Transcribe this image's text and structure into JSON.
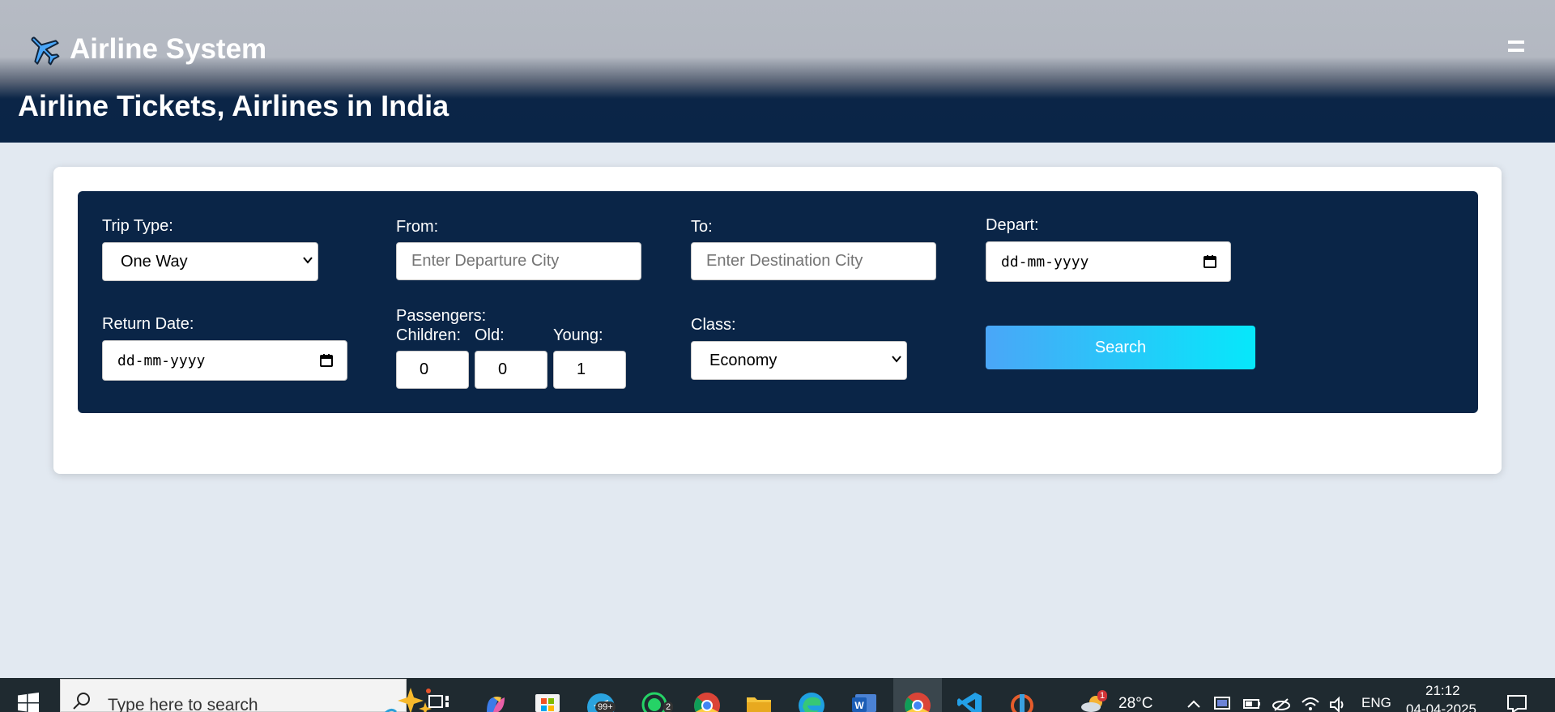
{
  "header": {
    "brand_icon": "airplane-icon",
    "brand_name": "Airline System",
    "menu_icon": "hamburger-menu-icon",
    "page_title": "Airline Tickets, Airlines in India"
  },
  "form": {
    "trip_type": {
      "label": "Trip Type:",
      "value": "One Way"
    },
    "from": {
      "label": "From:",
      "placeholder": "Enter Departure City"
    },
    "to": {
      "label": "To:",
      "placeholder": "Enter Destination City"
    },
    "depart": {
      "label": "Depart:",
      "value": "dd-mm-yyyy"
    },
    "return_date": {
      "label": "Return Date:",
      "value": "dd-mm-yyyy"
    },
    "passengers": {
      "label": "Passengers:",
      "children": {
        "label": "Children:",
        "value": "0"
      },
      "old": {
        "label": "Old:",
        "value": "0"
      },
      "young": {
        "label": "Young:",
        "value": "1"
      }
    },
    "class": {
      "label": "Class:",
      "value": "Economy"
    },
    "search_button": "Search"
  },
  "taskbar": {
    "search_placeholder": "Type here to search",
    "apps": [
      "task-view",
      "copilot",
      "microsoft-store",
      "telegram",
      "whatsapp",
      "chrome",
      "file-explorer",
      "edge",
      "word",
      "chrome-active",
      "vscode",
      "git-app"
    ],
    "telegram_badge": "99+",
    "whatsapp_badge": "2",
    "weather_badge": "1",
    "temperature": "28°C",
    "language": "ENG",
    "time": "21:12",
    "date": "04-04-2025"
  },
  "colors": {
    "navy": "#0a2547",
    "page_bg": "#e2e9f1",
    "search_gradient_start": "#4aa6f8",
    "search_gradient_end": "#06e8fa"
  }
}
